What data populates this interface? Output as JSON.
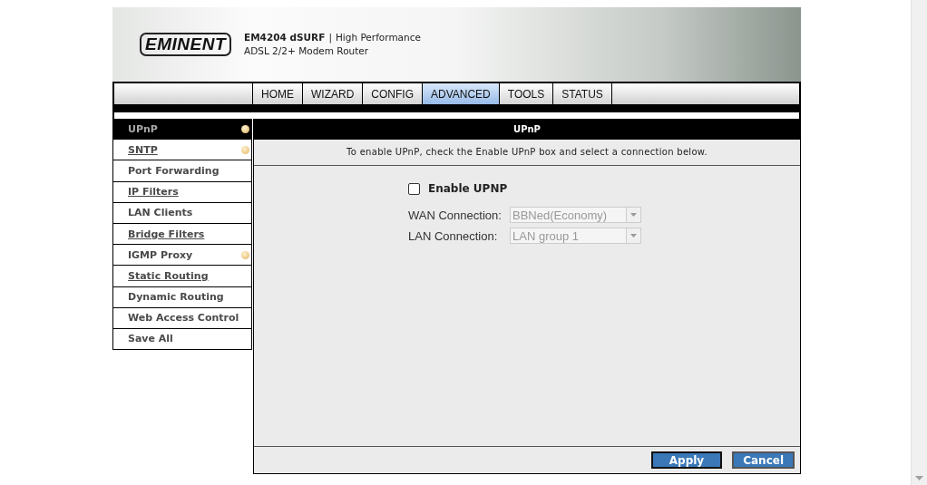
{
  "header": {
    "logo": "EMINENT",
    "product": "EM4204 dSURF",
    "separator": "|",
    "tagline": "High Performance",
    "subtitle": "ADSL 2/2+ Modem Router"
  },
  "tabs": [
    {
      "label": "HOME",
      "selected": false
    },
    {
      "label": "WIZARD",
      "selected": false
    },
    {
      "label": "CONFIG",
      "selected": false
    },
    {
      "label": "ADVANCED",
      "selected": true
    },
    {
      "label": "TOOLS",
      "selected": false
    },
    {
      "label": "STATUS",
      "selected": false
    }
  ],
  "sidebar": {
    "items": [
      {
        "label": "UPnP",
        "selected": true,
        "underlined": false,
        "dot": true
      },
      {
        "label": "SNTP",
        "selected": false,
        "underlined": true,
        "dot": true
      },
      {
        "label": "Port Forwarding",
        "selected": false,
        "underlined": false,
        "dot": false
      },
      {
        "label": "IP Filters",
        "selected": false,
        "underlined": true,
        "dot": false
      },
      {
        "label": "LAN Clients",
        "selected": false,
        "underlined": false,
        "dot": false
      },
      {
        "label": "Bridge Filters",
        "selected": false,
        "underlined": true,
        "dot": false
      },
      {
        "label": "IGMP Proxy",
        "selected": false,
        "underlined": false,
        "dot": true
      },
      {
        "label": "Static Routing",
        "selected": false,
        "underlined": true,
        "dot": false
      },
      {
        "label": "Dynamic Routing",
        "selected": false,
        "underlined": false,
        "dot": false
      },
      {
        "label": "Web Access Control",
        "selected": false,
        "underlined": false,
        "dot": false
      },
      {
        "label": "Save All",
        "selected": false,
        "underlined": false,
        "dot": false
      }
    ]
  },
  "panel": {
    "title": "UPnP",
    "description": "To enable UPnP, check the Enable UPnP box and select a connection below.",
    "enable": {
      "label": "Enable UPNP",
      "checked": false
    },
    "fields": [
      {
        "label": "WAN Connection:",
        "value": "BBNed(Economy)",
        "disabled": true
      },
      {
        "label": "LAN Connection:",
        "value": "LAN group 1",
        "disabled": true
      }
    ],
    "buttons": [
      {
        "label": "Apply",
        "focused": true
      },
      {
        "label": "Cancel",
        "focused": false
      }
    ]
  }
}
